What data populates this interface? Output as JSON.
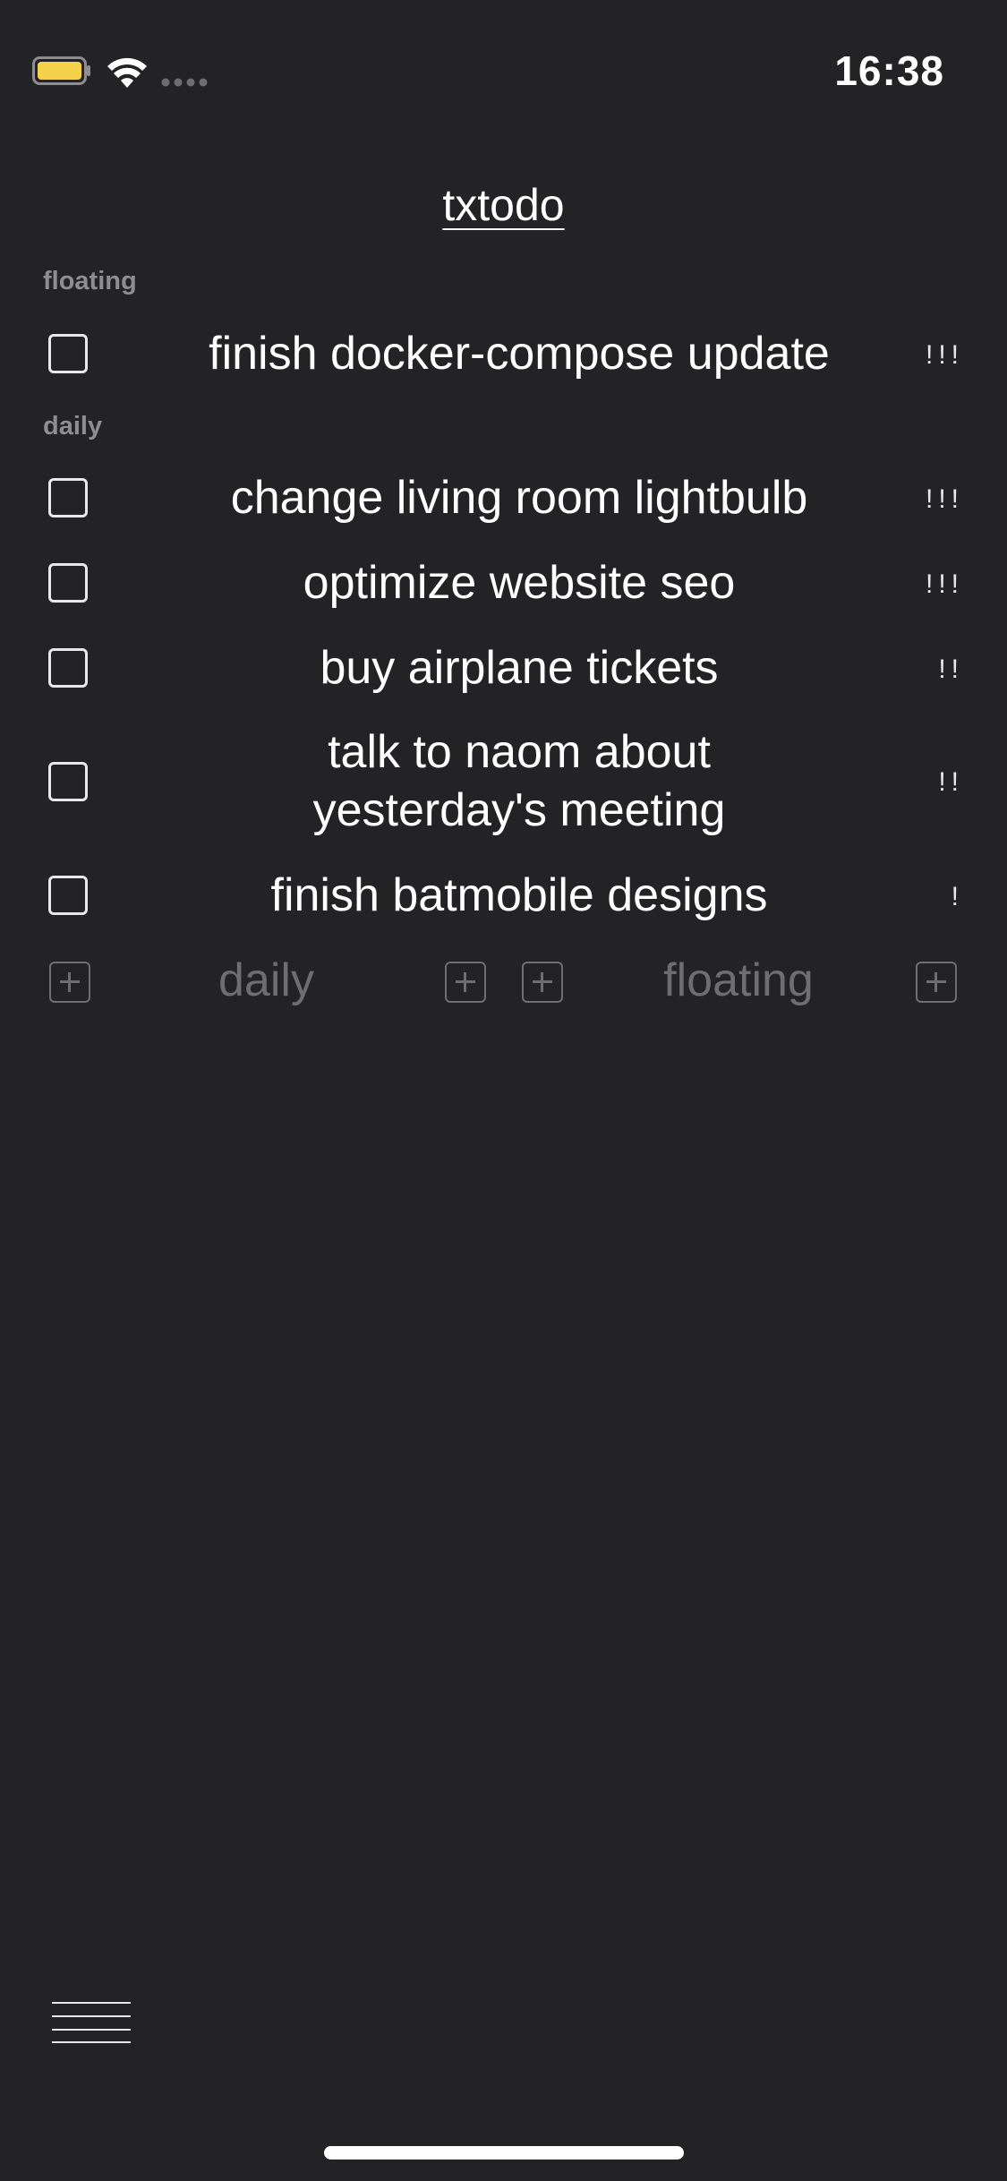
{
  "status_bar": {
    "time": "16:38",
    "battery_color": "#f4d24b"
  },
  "app": {
    "title": "txtodo"
  },
  "sections": {
    "floating": {
      "header": "floating",
      "items": [
        {
          "text": "finish docker-compose update",
          "priority": "!!!"
        }
      ]
    },
    "daily": {
      "header": "daily",
      "items": [
        {
          "text": "change living room lightbulb",
          "priority": "!!!"
        },
        {
          "text": "optimize website seo",
          "priority": "!!!"
        },
        {
          "text": "buy airplane tickets",
          "priority": "!!"
        },
        {
          "text": "talk to naom about yesterday's meeting",
          "priority": "!!"
        },
        {
          "text": "finish batmobile designs",
          "priority": "!"
        }
      ]
    }
  },
  "add_row": {
    "daily_label": "daily",
    "floating_label": "floating"
  },
  "icons": {
    "menu": "hamburger-menu-icon",
    "add": "plus-square-icon",
    "checkbox": "empty-checkbox"
  },
  "colors": {
    "background": "#232325",
    "text": "#ffffff",
    "muted": "#6e6e72",
    "section_header": "#8e8e92"
  }
}
